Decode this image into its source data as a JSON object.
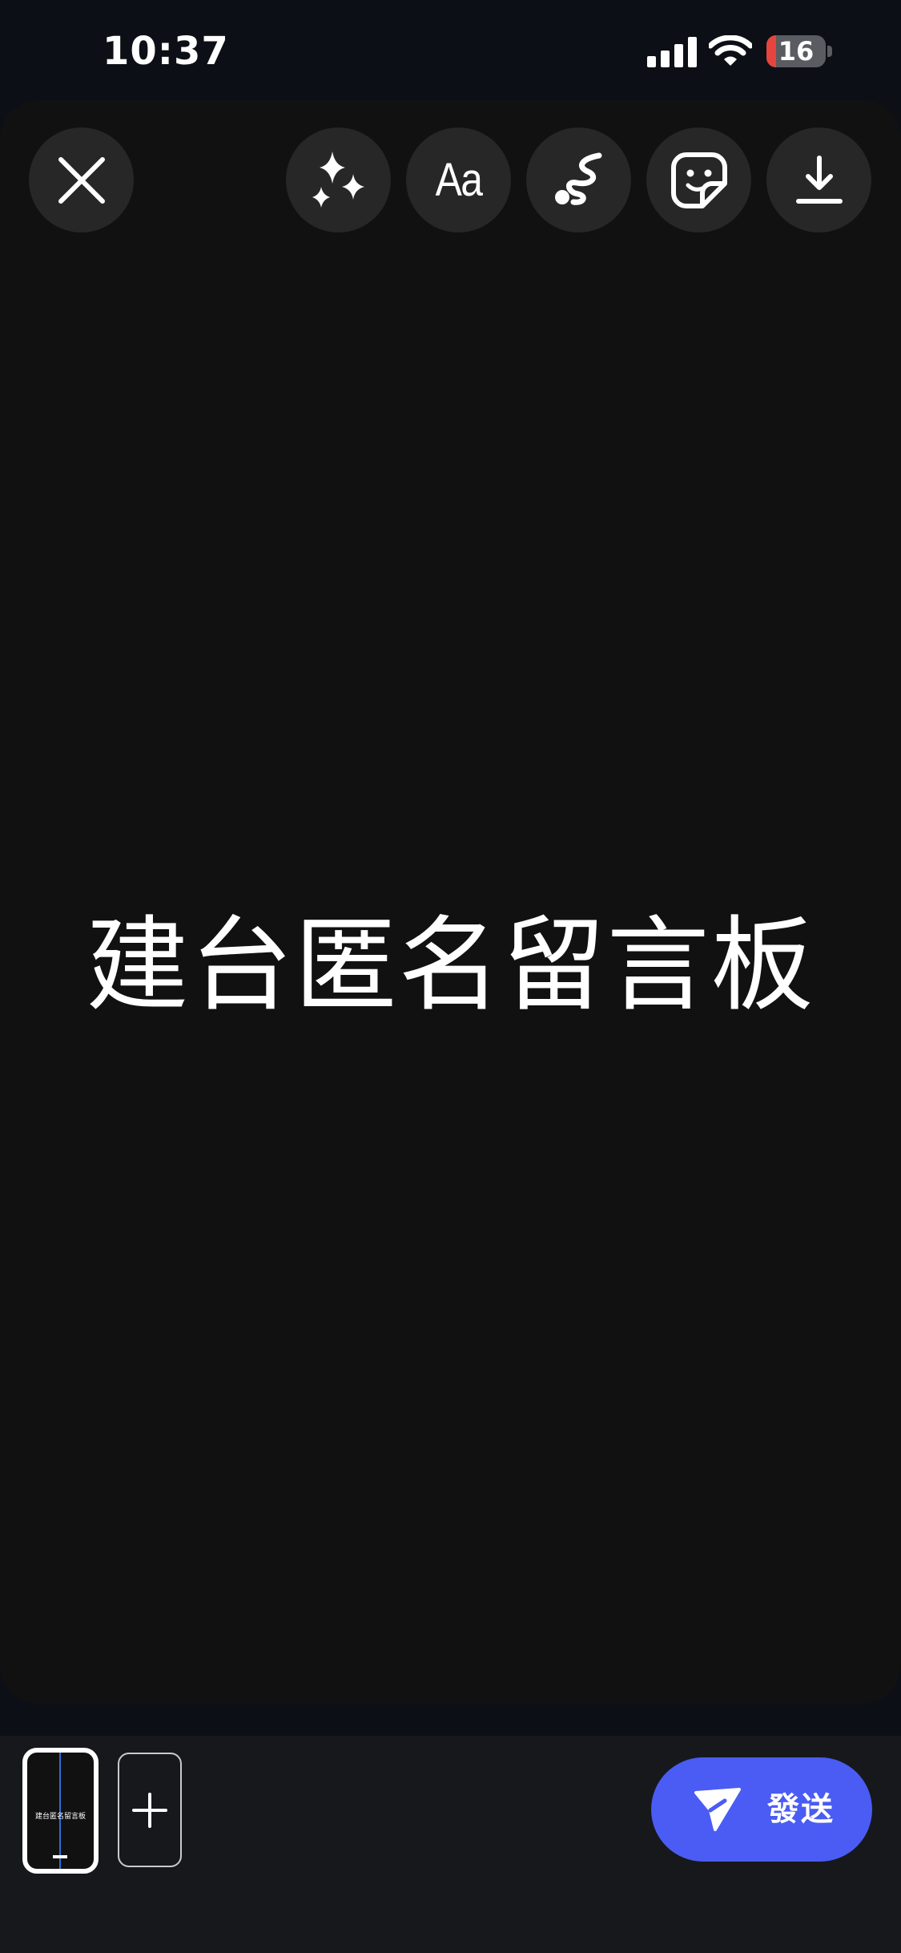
{
  "status_bar": {
    "time": "10:37",
    "battery_percent": "16",
    "battery_level": 0.16,
    "battery_color": "#e5453c"
  },
  "toolbar": {
    "close_icon": "close-icon",
    "effects_icon": "sparkles-icon",
    "text_tool_label": "Aa",
    "draw_icon": "squiggle-draw-icon",
    "sticker_icon": "sticker-icon",
    "download_icon": "download-icon"
  },
  "canvas": {
    "text": "建台匿名留言板",
    "background_color": "#111112"
  },
  "bottom_bar": {
    "thumbnail_text": "建台匿名留言板",
    "add_page_icon": "plus-icon",
    "send_label": "發送",
    "send_icon": "send-arrow-icon",
    "accent_color": "#4a5cf4"
  }
}
